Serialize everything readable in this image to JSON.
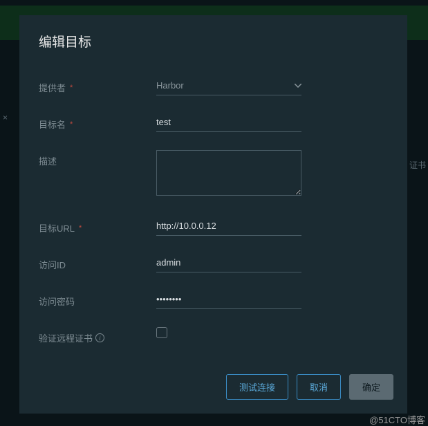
{
  "modal": {
    "title": "编辑目标"
  },
  "form": {
    "provider": {
      "label": "提供者",
      "value": "Harbor"
    },
    "name": {
      "label": "目标名",
      "value": "test"
    },
    "description": {
      "label": "描述",
      "value": ""
    },
    "url": {
      "label": "目标URL",
      "value": "http://10.0.0.12"
    },
    "accessId": {
      "label": "访问ID",
      "value": "admin"
    },
    "accessSecret": {
      "label": "访问密码",
      "value": "••••••••"
    },
    "verifyCert": {
      "label": "验证远程证书"
    }
  },
  "buttons": {
    "test": "测试连接",
    "cancel": "取消",
    "confirm": "确定"
  },
  "watermark": "@51CTO博客",
  "bg": {
    "cert": "证书"
  }
}
